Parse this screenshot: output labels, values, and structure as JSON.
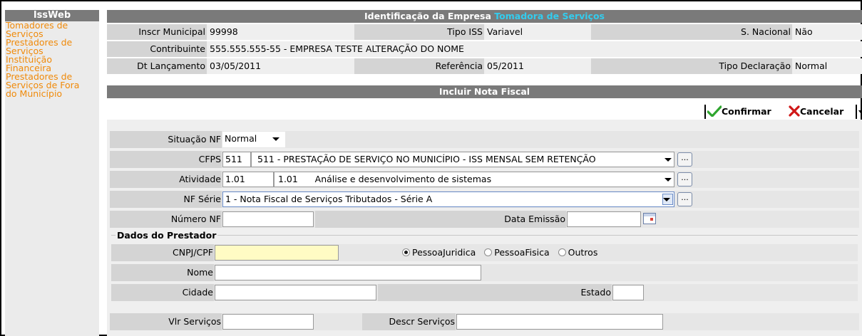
{
  "sidebar": {
    "title": "IssWeb",
    "links": [
      {
        "line1": "Tomadores de",
        "line2": "Serviços"
      },
      {
        "line1": "Prestadores de",
        "line2": "Serviços"
      },
      {
        "line1": "Instituição",
        "line2": "Financeira"
      },
      {
        "line1": "Prestadores de",
        "line2": "Serviços de Fora",
        "line3": "do Município"
      }
    ]
  },
  "header": {
    "title_prefix": "Identificação da Empresa",
    "title_accent": "Tomadora de Serviços"
  },
  "company": {
    "inscr_label": "Inscr Municipal",
    "inscr_value": "99998",
    "tipo_iss_label": "Tipo ISS",
    "tipo_iss_value": "Variavel",
    "snacional_label": "S. Nacional",
    "snacional_value": "Não",
    "contrib_label": "Contribuinte",
    "contrib_value": "555.555.555-55 - EMPRESA TESTE ALTERAÇÃO DO NOME",
    "dt_label": "Dt Lançamento",
    "dt_value": "03/05/2011",
    "ref_label": "Referência",
    "ref_value": "05/2011",
    "tipodecl_label": "Tipo Declaração",
    "tipodecl_value": "Normal"
  },
  "section": {
    "title": "Incluir Nota Fiscal"
  },
  "toolbar": {
    "confirm": "Confirmar",
    "cancel": "Cancelar"
  },
  "form": {
    "situacao_label": "Situação NF",
    "situacao_value": "Normal",
    "cfps_label": "CFPS",
    "cfps_code": "511",
    "cfps_desc": "511 - PRESTAÇÃO DE SERVIÇO NO MUNICÍPIO - ISS MENSAL SEM RETENÇÃO",
    "atividade_label": "Atividade",
    "atividade_code": "1.01",
    "atividade_desc": "1.01      Análise e desenvolvimento de sistemas",
    "serie_label": "NF Série",
    "serie_value": "1 - Nota Fiscal de Serviços Tributados - Série A",
    "numero_label": "Número NF",
    "numero_value": "",
    "data_label": "Data Emissão",
    "data_value": "",
    "dots": "..."
  },
  "prestador": {
    "legend": "Dados do Prestador",
    "cnpj_label": "CNPJ/CPF",
    "cnpj_value": "",
    "radio_pj": "PessoaJuridica",
    "radio_pf": "PessoaFisica",
    "radio_outros": "Outros",
    "nome_label": "Nome",
    "nome_value": "",
    "cidade_label": "Cidade",
    "cidade_value": "",
    "estado_label": "Estado",
    "estado_value": ""
  },
  "servicos": {
    "vlr_label": "Vlr Serviços",
    "vlr_value": "",
    "descr_label": "Descr Serviços",
    "descr_value": ""
  },
  "colors": {
    "accent": "#33ccee",
    "link": "#f08a0a",
    "header": "#7a7a7a",
    "confirm": "#2ea52e",
    "cancel": "#d01818"
  }
}
